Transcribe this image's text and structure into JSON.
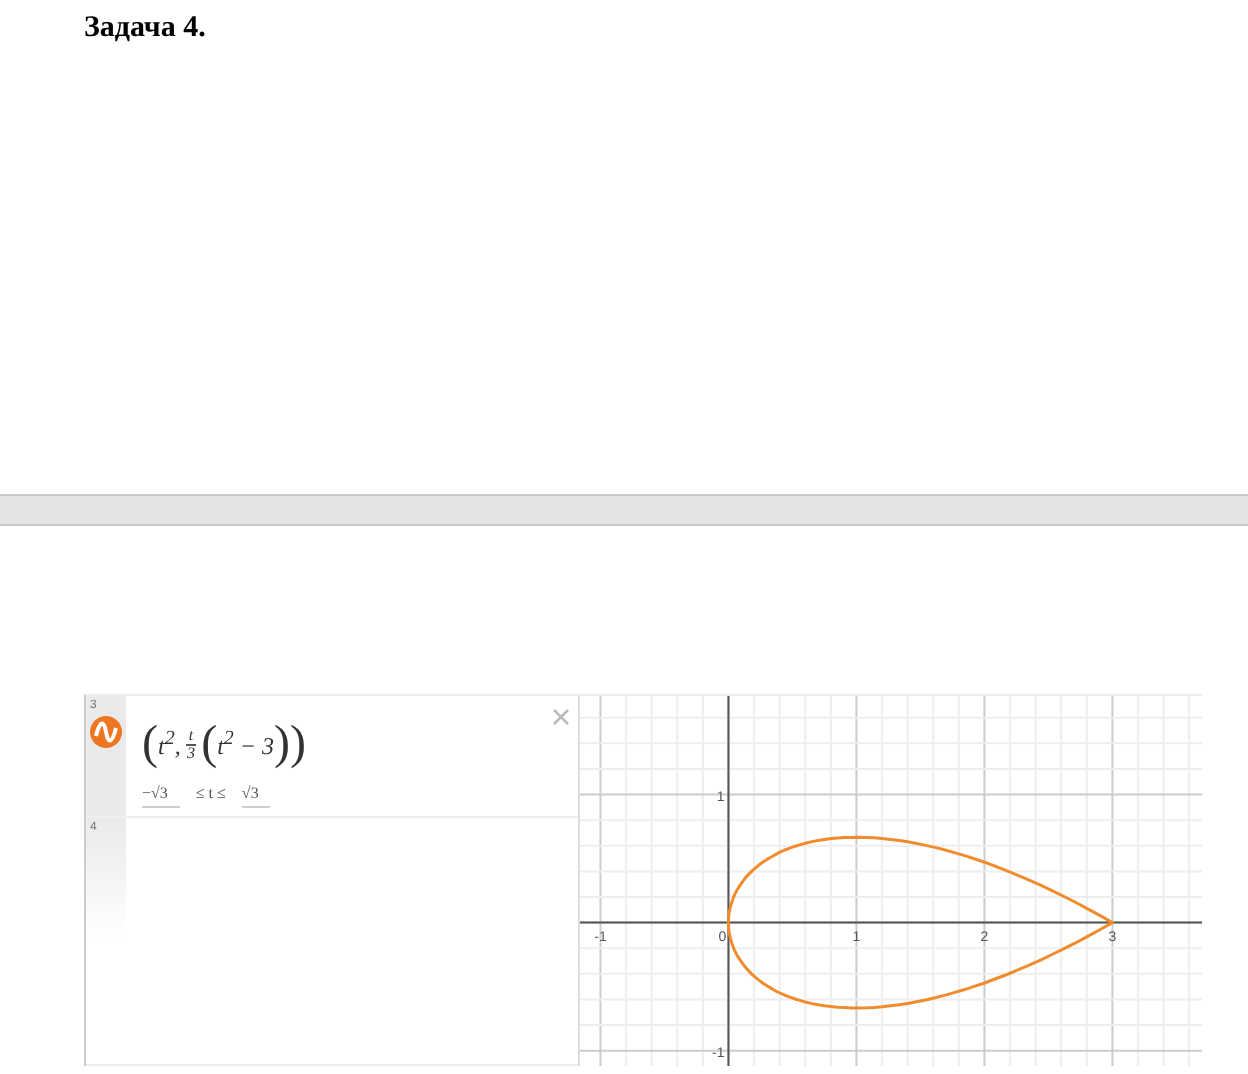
{
  "heading": "Задача 4.",
  "expressions": [
    {
      "number": "3",
      "tokens": [
        {
          "kind": "paren",
          "text": "("
        },
        {
          "kind": "text",
          "text": "t$^{2}$, "
        },
        {
          "kind": "fraction",
          "num": "t",
          "den": "3"
        },
        {
          "kind": "paren",
          "text": "("
        },
        {
          "kind": "text",
          "text": "t$^{2}$ − 3"
        },
        {
          "kind": "paren",
          "text": ")"
        },
        {
          "kind": "paren",
          "text": ")"
        }
      ],
      "domain": {
        "low": "−√3",
        "mid": "≤ t ≤",
        "high": "√3"
      }
    },
    {
      "number": "4"
    }
  ],
  "chart_data": {
    "type": "line",
    "xlim": [
      -1.16,
      3.7
    ],
    "ylim": [
      -1.12,
      1.77
    ],
    "xticks": [
      -1,
      0,
      1,
      2,
      3
    ],
    "yticks": [
      -1,
      1
    ],
    "grid": true
  }
}
